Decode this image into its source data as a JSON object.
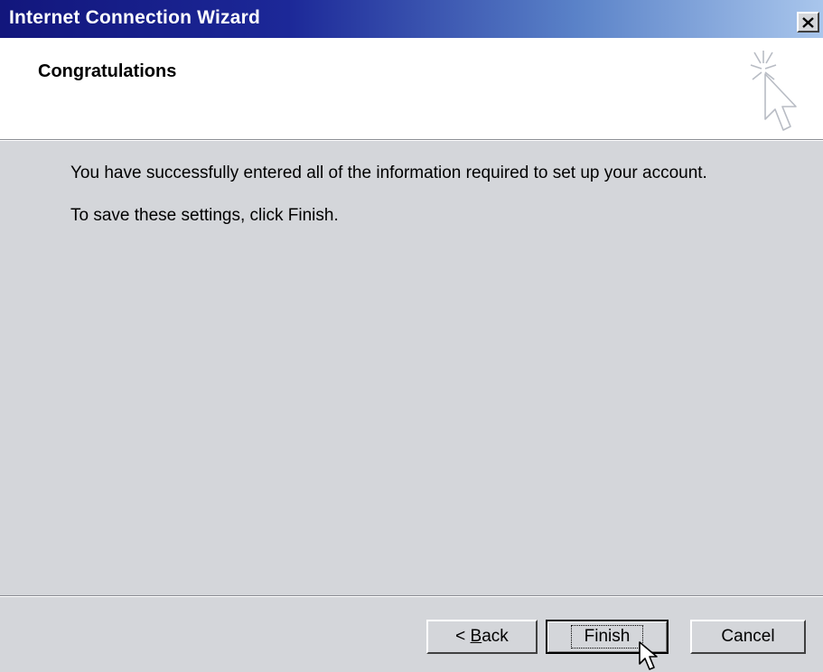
{
  "window": {
    "title": "Internet Connection Wizard"
  },
  "header": {
    "title": "Congratulations",
    "icon": "wizard-sparkle-cursor-icon"
  },
  "content": {
    "line1": "You have successfully entered all of the information required to set up your account.",
    "line2": "To save these settings, click Finish."
  },
  "buttons": {
    "back_prefix": "< ",
    "back_accel": "B",
    "back_rest": "ack",
    "finish": "Finish",
    "cancel": "Cancel"
  },
  "colors": {
    "titlebar_start": "#12167c",
    "titlebar_end": "#a9c6ec",
    "dialog_bg": "#d4d6da"
  }
}
